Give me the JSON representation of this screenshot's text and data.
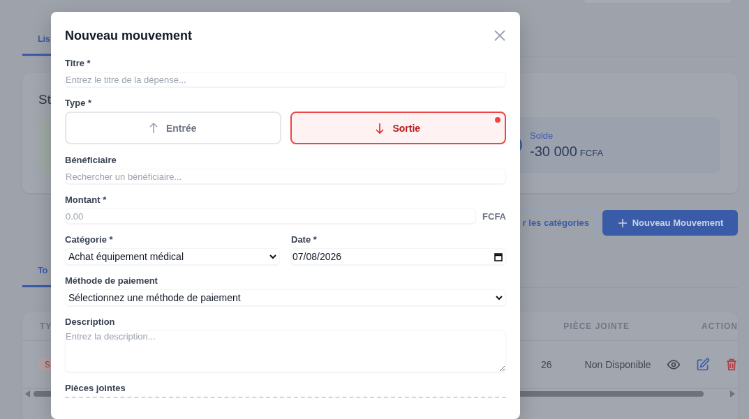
{
  "background_page": {
    "top_tab": {
      "label": "Lis",
      "selected": true
    },
    "stats": {
      "title": "St",
      "balance": {
        "label": "Solde",
        "amount": "-30 000",
        "currency": "FCFA"
      }
    },
    "buttons": [
      {
        "kind": "outline",
        "label": "r les catégories"
      },
      {
        "kind": "primary",
        "label": "Nouveau Mouvement"
      }
    ],
    "filter_tab": {
      "label": "To",
      "selected": true
    },
    "table": {
      "columns": [
        "TY",
        "PIÈCE JOINTE",
        "ACTION"
      ],
      "rows": [
        {
          "type_badge": "S",
          "column_2": "26",
          "attachment": "Non Disponible"
        }
      ]
    }
  },
  "modal": {
    "title": "Nouveau mouvement",
    "fields": [
      {
        "kind": "text",
        "label": "Titre *",
        "placeholder": "Entrez le titre de la dépense..."
      },
      {
        "kind": "toggle",
        "label": "Type *",
        "options": [
          {
            "kind": "in",
            "label": "Entrée",
            "selected": false
          },
          {
            "kind": "out",
            "label": "Sortie",
            "selected": true
          }
        ]
      },
      {
        "kind": "text",
        "label": "Bénéficiaire",
        "placeholder": "Rechercher un bénéficiaire..."
      },
      {
        "kind": "amount",
        "label": "Montant *",
        "placeholder": "0.00",
        "unit": "FCFA"
      },
      {
        "kind": "pair",
        "fields": [
          {
            "kind": "select",
            "label": "Catégorie *",
            "value": "Achat équipement médical"
          },
          {
            "kind": "date",
            "label": "Date *",
            "value": "07/08/2026"
          }
        ]
      },
      {
        "kind": "select",
        "label": "Méthode de paiement",
        "value": "Sélectionnez une méthode de paiement"
      },
      {
        "kind": "textarea",
        "label": "Description",
        "placeholder": "Entrez la description..."
      },
      {
        "kind": "upload",
        "label": "Pièces jointes"
      }
    ]
  }
}
